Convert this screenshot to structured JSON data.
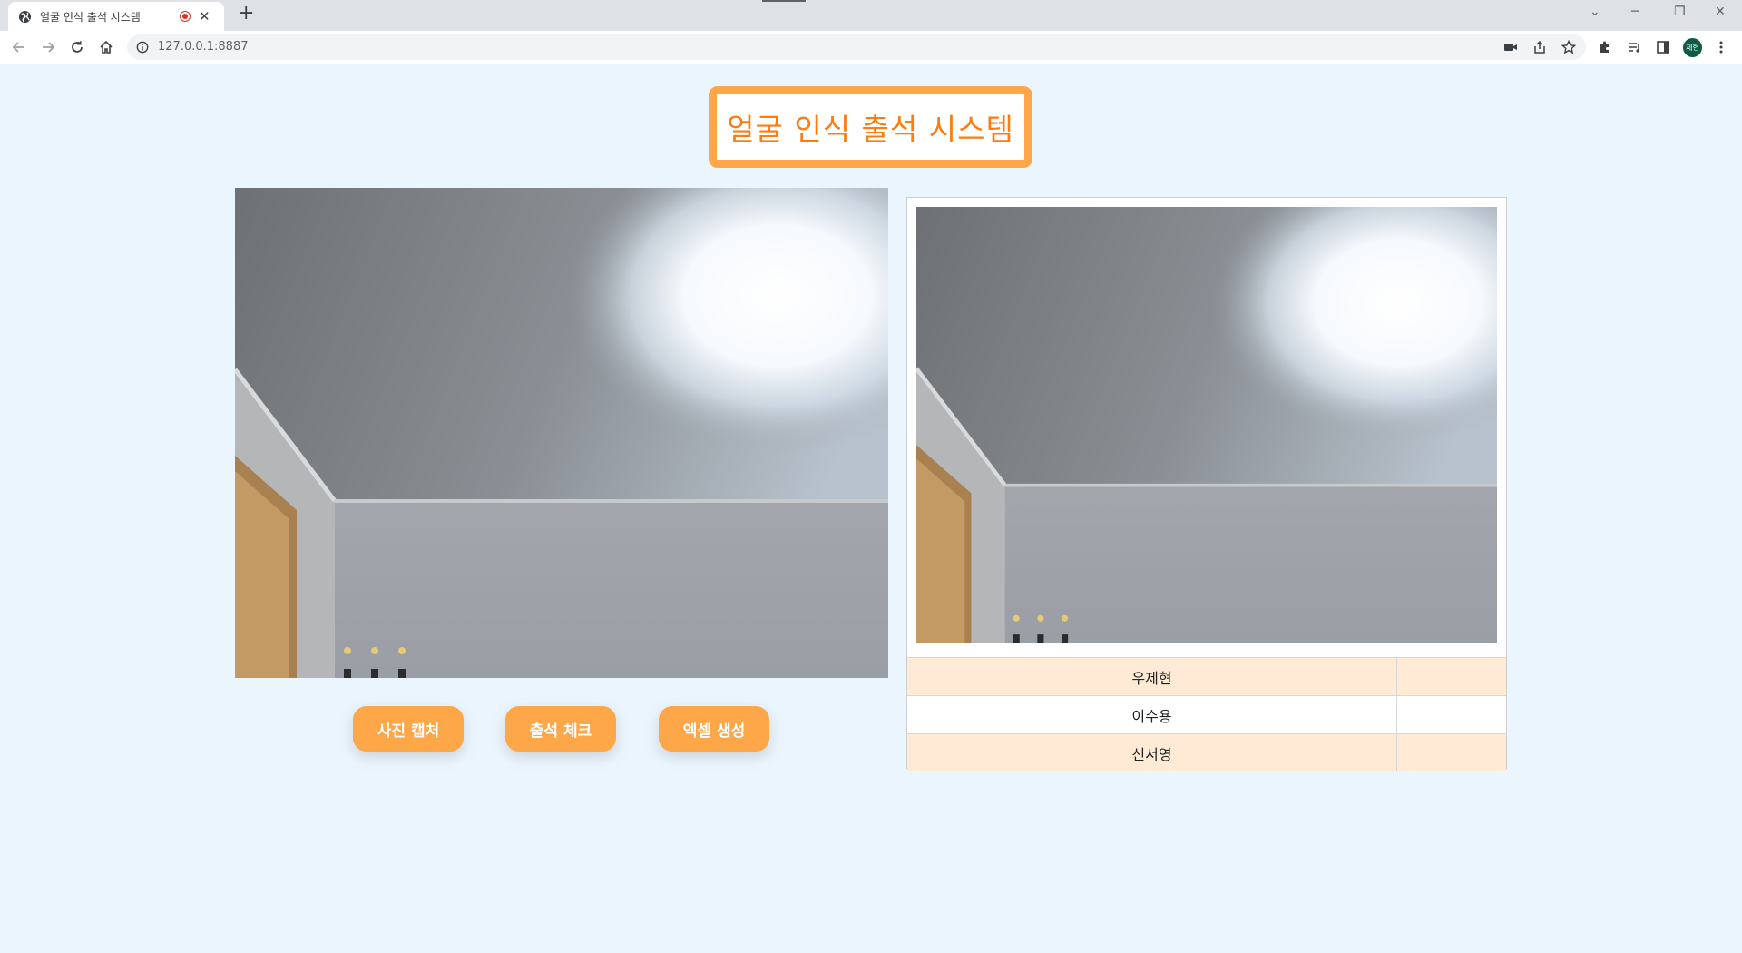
{
  "browser": {
    "tab_title": "얼굴 인식 출석 시스템",
    "url": "127.0.0.1:8887",
    "profile_label": "제현"
  },
  "page": {
    "title": "얼굴 인식 출석 시스템",
    "buttons": {
      "capture": "사진 캡처",
      "check": "출석 체크",
      "excel": "엑셀 생성"
    },
    "attendance": [
      {
        "name": "우제현",
        "status": ""
      },
      {
        "name": "이수용",
        "status": ""
      },
      {
        "name": "신서영",
        "status": ""
      }
    ]
  },
  "colors": {
    "accent": "#fea748",
    "title_text": "#fe7b0d",
    "page_bg": "#ebf5fe",
    "row_highlight": "#ffebd5"
  },
  "icons": [
    "globe-icon",
    "recording-icon",
    "close-icon",
    "plus-icon",
    "back-icon",
    "forward-icon",
    "reload-icon",
    "home-icon",
    "info-icon",
    "camera-icon",
    "share-icon",
    "star-icon",
    "extensions-icon",
    "reading-list-icon",
    "sidepanel-icon",
    "menu-icon"
  ]
}
